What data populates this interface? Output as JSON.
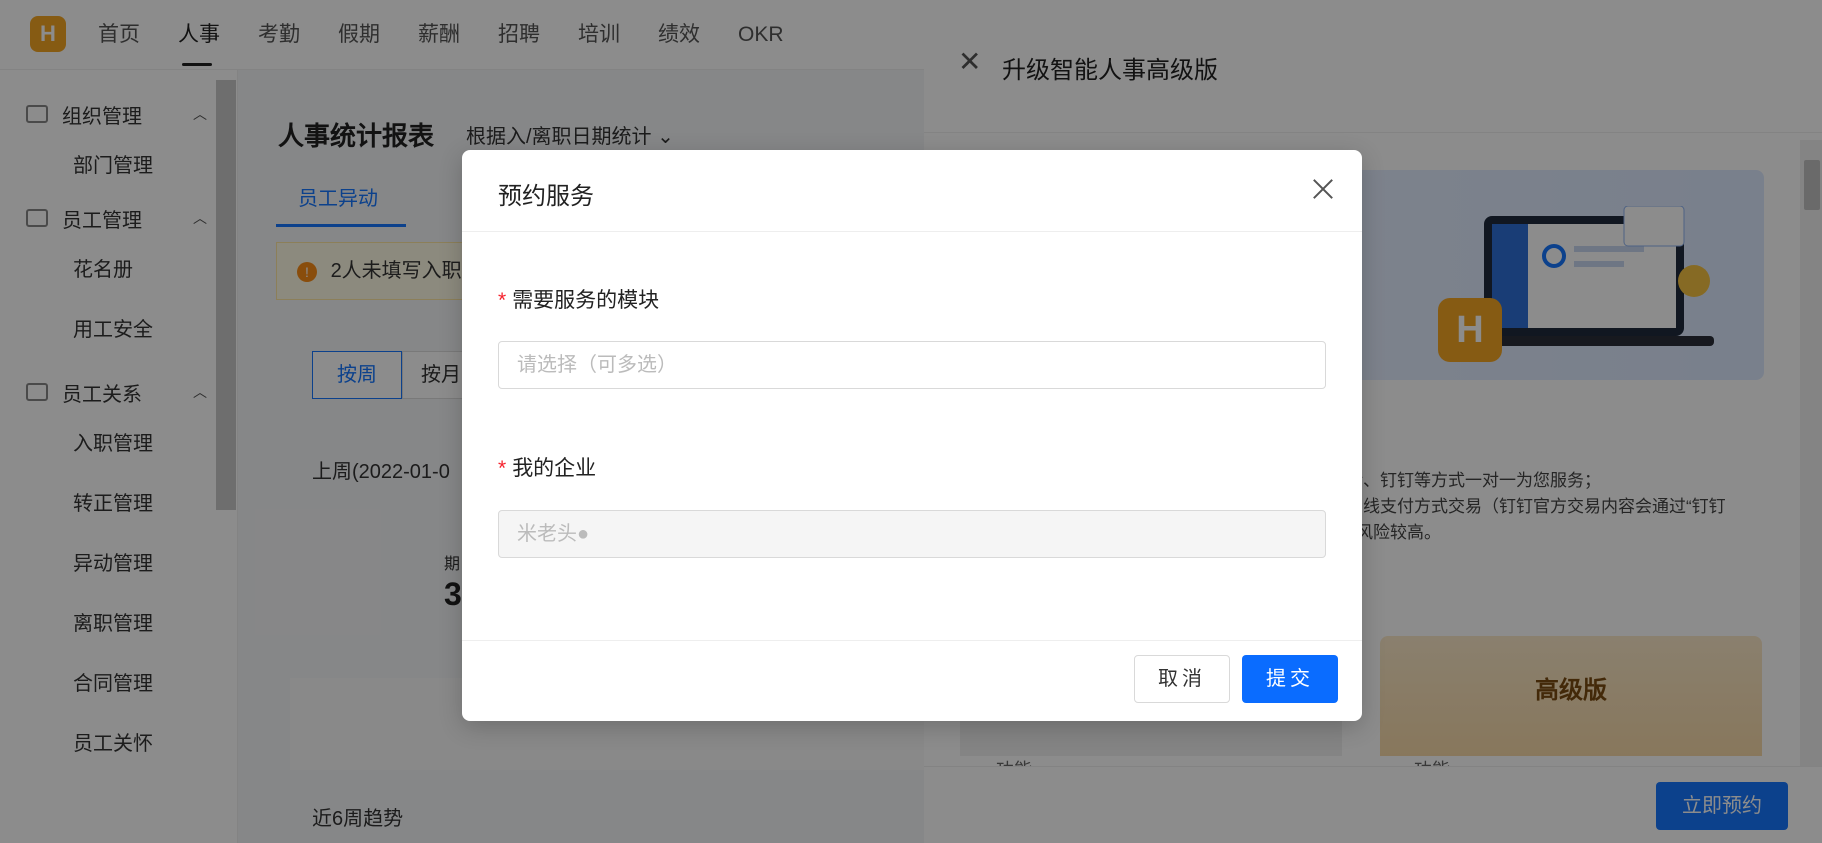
{
  "topnav": {
    "logo": "H",
    "items": [
      {
        "label": "首页"
      },
      {
        "label": "人事"
      },
      {
        "label": "考勤"
      },
      {
        "label": "假期"
      },
      {
        "label": "薪酬"
      },
      {
        "label": "招聘"
      },
      {
        "label": "培训"
      },
      {
        "label": "绩效"
      },
      {
        "label": "OKR"
      }
    ],
    "active": "人事"
  },
  "sidebar": {
    "groups": [
      {
        "label": "组织管理",
        "items": [
          "部门管理"
        ]
      },
      {
        "label": "员工管理",
        "items": [
          "花名册",
          "用工安全"
        ]
      },
      {
        "label": "员工关系",
        "items": [
          "入职管理",
          "转正管理",
          "异动管理",
          "离职管理",
          "合同管理",
          "员工关怀"
        ]
      }
    ]
  },
  "content": {
    "title": "人事统计报表",
    "subtitle": "根据入/离职日期统计",
    "tab": "员工异动",
    "warning": "2人未填写入职",
    "seg_week": "按周",
    "seg_month": "按月",
    "period": "上周(2022-01-0",
    "stat_label": "期",
    "stat_value": "3",
    "trend": "近6周趋势"
  },
  "drawer": {
    "title": "升级智能人事高级版",
    "note_line1": "话、钉钉等方式一对一为您服务；",
    "note_line2": "在线支付方式交易（钉钉官方交易内容会通过“钉钉",
    "note_line3": "风险较高。",
    "plan_advanced": "高级版",
    "feature_left": "功能",
    "feature_right": "功能",
    "reserve_button": "立即预约"
  },
  "modal": {
    "title": "预约服务",
    "field1_label": "需要服务的模块",
    "field1_placeholder": "请选择（可多选）",
    "field2_label": "我的企业",
    "field2_value": "米老头",
    "cancel": "取消",
    "submit": "提交"
  },
  "colors": {
    "primary": "#1677ff",
    "brand": "#f5a623",
    "required": "#f5222d"
  }
}
